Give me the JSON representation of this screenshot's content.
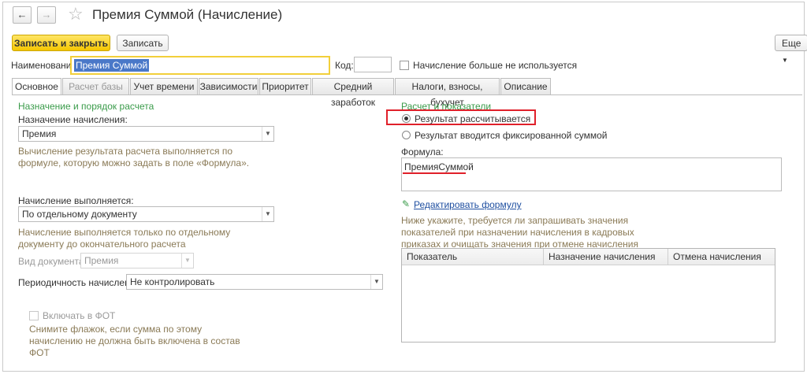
{
  "nav": {
    "back_glyph": "←",
    "forward_glyph": "→",
    "star_glyph": "☆"
  },
  "window": {
    "title": "Премия Суммой (Начисление)"
  },
  "toolbar": {
    "save_close_label": "Записать и закрыть",
    "save_label": "Записать",
    "more_label": "Еще"
  },
  "header": {
    "name_label": "Наименование:",
    "name_value": "Премия Суммой",
    "code_label": "Код:",
    "code_value": "",
    "unused_label": "Начисление больше не используется"
  },
  "tabs": [
    {
      "label": "Основное"
    },
    {
      "label": "Расчет базы"
    },
    {
      "label": "Учет времени"
    },
    {
      "label": "Зависимости"
    },
    {
      "label": "Приоритет"
    },
    {
      "label": "Средний заработок"
    },
    {
      "label": "Налоги, взносы, бухучет"
    },
    {
      "label": "Описание"
    }
  ],
  "left": {
    "section_title": "Назначение и порядок расчета",
    "purpose_label": "Назначение начисления:",
    "purpose_value": "Премия",
    "purpose_hint": "Вычисление результата расчета выполняется по формуле, которую можно задать в поле «Формула».",
    "performed_label": "Начисление выполняется:",
    "performed_value": "По отдельному документу",
    "performed_hint": "Начисление выполняется только по отдельному документу до окончательного расчета",
    "doc_type_label": "Вид документа:",
    "doc_type_value": "Премия",
    "periodicity_label": "Периодичность начисления:",
    "periodicity_value": "Не контролировать",
    "fot_label": "Включать в ФОТ",
    "fot_hint": "Снимите флажок, если сумма по этому начислению не должна быть включена в состав ФОТ"
  },
  "right": {
    "section_title": "Расчет и показатели",
    "radio_calculated": "Результат рассчитывается",
    "radio_fixed": "Результат вводится фиксированной суммой",
    "formula_label": "Формула:",
    "formula_value": "ПремияСуммой",
    "edit_formula_link": "Редактировать формулу",
    "indicators_hint": "Ниже укажите, требуется ли запрашивать значения показателей при назначении начисления в кадровых приказах и очищать значения при отмене начисления",
    "table_headers": [
      "Показатель",
      "Назначение начисления",
      "Отмена начисления"
    ]
  },
  "colors": {
    "accent_yellow": "#f5c600",
    "highlight_red": "#e0202a",
    "section_green": "#3a9b4a",
    "hint_brown": "#8a7a56"
  }
}
